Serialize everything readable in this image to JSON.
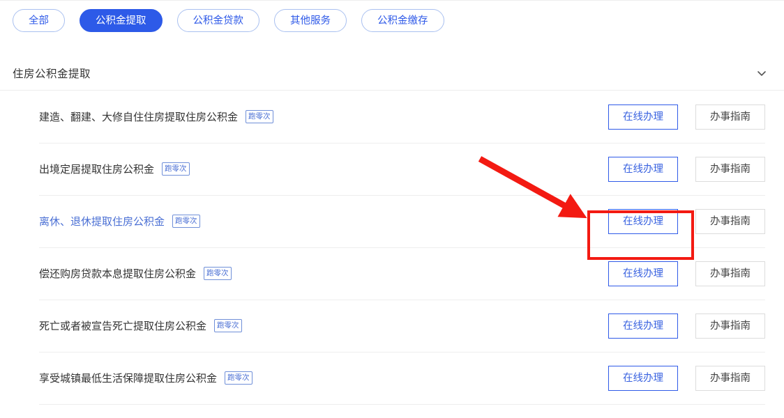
{
  "filters": {
    "items": [
      {
        "label": "全部",
        "active": false
      },
      {
        "label": "公积金提取",
        "active": true
      },
      {
        "label": "公积金贷款",
        "active": false
      },
      {
        "label": "其他服务",
        "active": false
      },
      {
        "label": "公积金缴存",
        "active": false
      }
    ]
  },
  "section": {
    "title": "住房公积金提取",
    "collapse_icon": "chevron-down-icon"
  },
  "buttons": {
    "primary_label": "在线办理",
    "secondary_label": "办事指南"
  },
  "services": [
    {
      "name": "建造、翻建、大修自住住房提取住房公积金",
      "tag": "跑零次",
      "highlighted": false
    },
    {
      "name": "出境定居提取住房公积金",
      "tag": "跑零次",
      "highlighted": false
    },
    {
      "name": "离休、退休提取住房公积金",
      "tag": "跑零次",
      "highlighted": true
    },
    {
      "name": "偿还购房贷款本息提取住房公积金",
      "tag": "跑零次",
      "highlighted": false
    },
    {
      "name": "死亡或者被宣告死亡提取住房公积金",
      "tag": "跑零次",
      "highlighted": false
    },
    {
      "name": "享受城镇最低生活保障提取住房公积金",
      "tag": "跑零次",
      "highlighted": false
    }
  ],
  "annotation": {
    "highlight_box_target": "在线办理",
    "arrow_color": "#f31a12",
    "box_color": "#f31a12"
  },
  "colors": {
    "accent_blue": "#2d5ae8",
    "link_blue": "#4a6fd4",
    "border_gray": "#dcdcdc",
    "divider": "#eeeeee"
  }
}
